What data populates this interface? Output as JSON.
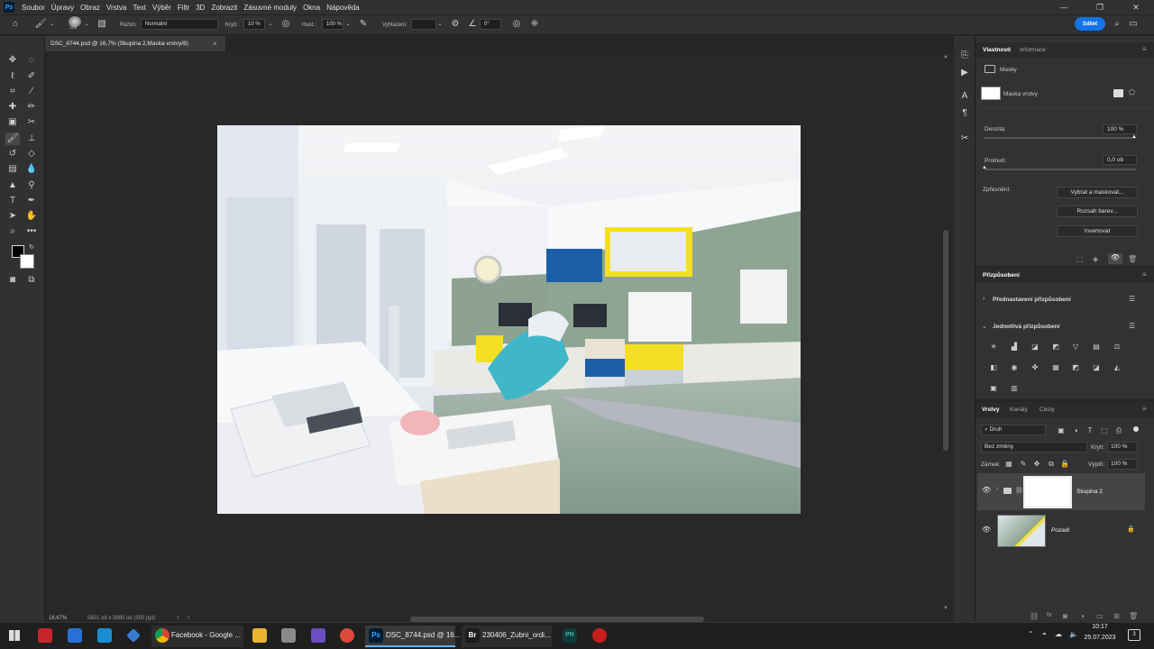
{
  "app": {
    "logo": "Ps"
  },
  "menu": [
    "Soubor",
    "Úpravy",
    "Obraz",
    "Vrstva",
    "Text",
    "Výběr",
    "Filtr",
    "3D",
    "Zobrazit",
    "Zásuvné moduly",
    "Okna",
    "Nápověda"
  ],
  "options": {
    "brush_size": "308",
    "mode_label": "Režim:",
    "mode_value": "Normální",
    "opacity_label": "Krytí:",
    "opacity_value": "10 %",
    "flow_label": "Hust.:",
    "flow_value": "100 %",
    "smoothing_label": "Vyhlazení:",
    "angle_value": "0°",
    "share_label": "Sdílet"
  },
  "document": {
    "tab_title": "DSC_8744.psd @ 16,7% (Skupina 2,Maska vrstvy/8)",
    "close": "×",
    "zoom": "16,67%",
    "info": "5821 ob x 3880 ob (300 ppi)"
  },
  "properties": {
    "tab1": "Vlastnosti",
    "tab2": "Informace",
    "section": "Masky",
    "mask_label": "Maska vrstvy",
    "density_label": "Denzita:",
    "density_value": "100 %",
    "feather_label": "Prolnutí:",
    "feather_value": "0,0 ob",
    "refine_label": "Zpřesnění:",
    "btn_select_mask": "Vybrat a maskovat...",
    "btn_color_range": "Rozsah barev...",
    "btn_invert": "Invertovat"
  },
  "adjustments": {
    "tab": "Přizpůsobení",
    "presets": "Přednastavení přizpůsobení",
    "individual": "Jednotlivá přizpůsobení"
  },
  "layers": {
    "tab1": "Vrstvy",
    "tab2": "Kanály",
    "tab3": "Cesty",
    "filter_kind": "Druh",
    "blend_mode": "Bez změny",
    "opacity_label": "Krytí:",
    "opacity_value": "100 %",
    "lock_label": "Zámek:",
    "fill_label": "Výplň:",
    "fill_value": "100 %",
    "items": [
      {
        "name": "Skupina 2"
      },
      {
        "name": "Pozadí"
      }
    ]
  },
  "taskbar": {
    "chrome_label": "Facebook - Google ...",
    "ps_label": "DSC_8744.psd @ 16...",
    "br_label": "230406_Zubni_ordi...",
    "br_logo": "Br",
    "ps_logo": "Ps",
    "pr_logo": "PR",
    "time": "10:17",
    "date": "25.07.2023",
    "notif_count": "3"
  },
  "colors": {
    "accent": "#1473e6",
    "panel": "#323232",
    "bg": "#282828"
  }
}
